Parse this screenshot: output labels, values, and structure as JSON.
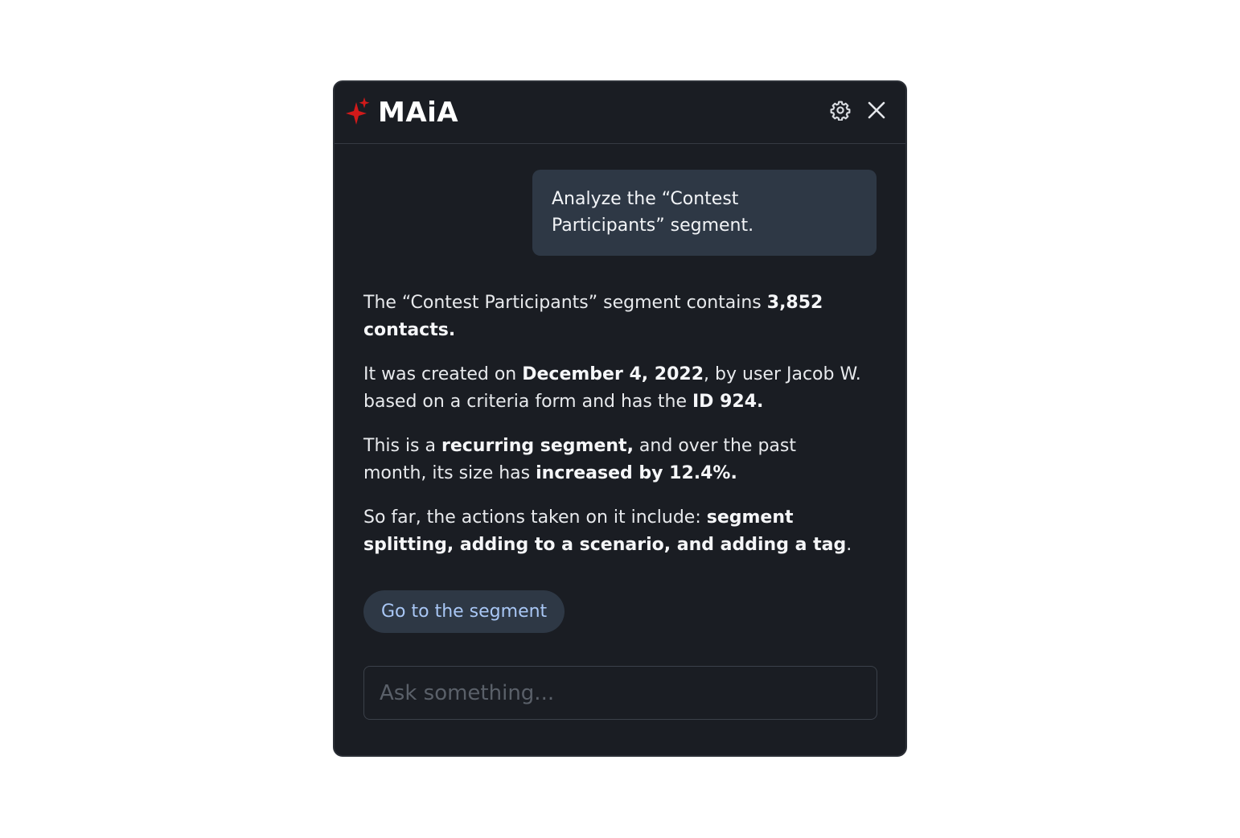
{
  "app": {
    "title": "MAiA",
    "logo_icon": "sparkle-icon",
    "accent_color": "#d11a1a"
  },
  "header": {
    "settings_icon": "gear-icon",
    "close_icon": "close-icon"
  },
  "conversation": {
    "user_message": "Analyze the “Contest Participants” segment.",
    "assistant_paragraphs": [
      [
        {
          "text": "The “Contest Participants” segment contains ",
          "bold": false
        },
        {
          "text": "3,852 contacts.",
          "bold": true
        }
      ],
      [
        {
          "text": "It was created on ",
          "bold": false
        },
        {
          "text": "December 4, 2022",
          "bold": true
        },
        {
          "text": ", by user Jacob W. based on a criteria form and has the ",
          "bold": false
        },
        {
          "text": "ID 924.",
          "bold": true
        }
      ],
      [
        {
          "text": "This is a ",
          "bold": false
        },
        {
          "text": "recurring segment,",
          "bold": true
        },
        {
          "text": " and over the past month, its size has ",
          "bold": false
        },
        {
          "text": "increased by 12.4%.",
          "bold": true
        }
      ],
      [
        {
          "text": "So far, the actions taken on it include: ",
          "bold": false
        },
        {
          "text": "segment splitting, adding to a scenario, and adding a tag",
          "bold": true
        },
        {
          "text": ".",
          "bold": false
        }
      ]
    ],
    "action_button_label": "Go to the segment"
  },
  "input": {
    "placeholder": "Ask something...",
    "value": ""
  }
}
